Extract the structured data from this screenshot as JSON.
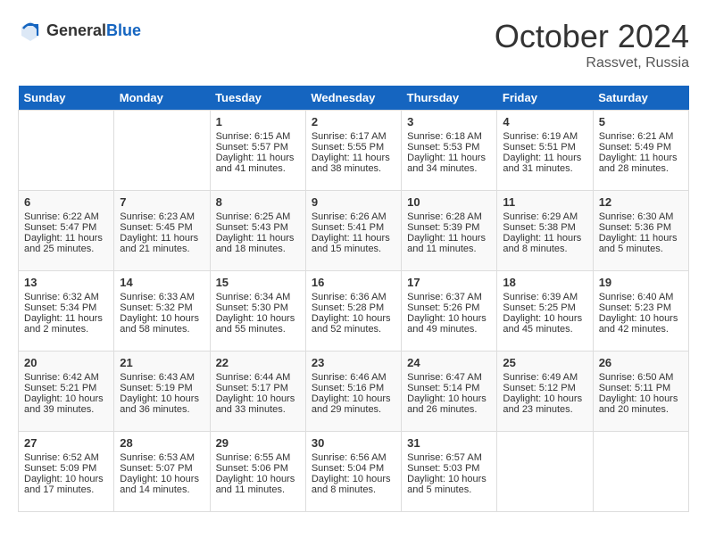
{
  "header": {
    "logo_general": "General",
    "logo_blue": "Blue",
    "month_title": "October 2024",
    "location": "Rassvet, Russia"
  },
  "days_of_week": [
    "Sunday",
    "Monday",
    "Tuesday",
    "Wednesday",
    "Thursday",
    "Friday",
    "Saturday"
  ],
  "weeks": [
    [
      {
        "day": "",
        "sunrise": "",
        "sunset": "",
        "daylight": ""
      },
      {
        "day": "",
        "sunrise": "",
        "sunset": "",
        "daylight": ""
      },
      {
        "day": "1",
        "sunrise": "Sunrise: 6:15 AM",
        "sunset": "Sunset: 5:57 PM",
        "daylight": "Daylight: 11 hours and 41 minutes."
      },
      {
        "day": "2",
        "sunrise": "Sunrise: 6:17 AM",
        "sunset": "Sunset: 5:55 PM",
        "daylight": "Daylight: 11 hours and 38 minutes."
      },
      {
        "day": "3",
        "sunrise": "Sunrise: 6:18 AM",
        "sunset": "Sunset: 5:53 PM",
        "daylight": "Daylight: 11 hours and 34 minutes."
      },
      {
        "day": "4",
        "sunrise": "Sunrise: 6:19 AM",
        "sunset": "Sunset: 5:51 PM",
        "daylight": "Daylight: 11 hours and 31 minutes."
      },
      {
        "day": "5",
        "sunrise": "Sunrise: 6:21 AM",
        "sunset": "Sunset: 5:49 PM",
        "daylight": "Daylight: 11 hours and 28 minutes."
      }
    ],
    [
      {
        "day": "6",
        "sunrise": "Sunrise: 6:22 AM",
        "sunset": "Sunset: 5:47 PM",
        "daylight": "Daylight: 11 hours and 25 minutes."
      },
      {
        "day": "7",
        "sunrise": "Sunrise: 6:23 AM",
        "sunset": "Sunset: 5:45 PM",
        "daylight": "Daylight: 11 hours and 21 minutes."
      },
      {
        "day": "8",
        "sunrise": "Sunrise: 6:25 AM",
        "sunset": "Sunset: 5:43 PM",
        "daylight": "Daylight: 11 hours and 18 minutes."
      },
      {
        "day": "9",
        "sunrise": "Sunrise: 6:26 AM",
        "sunset": "Sunset: 5:41 PM",
        "daylight": "Daylight: 11 hours and 15 minutes."
      },
      {
        "day": "10",
        "sunrise": "Sunrise: 6:28 AM",
        "sunset": "Sunset: 5:39 PM",
        "daylight": "Daylight: 11 hours and 11 minutes."
      },
      {
        "day": "11",
        "sunrise": "Sunrise: 6:29 AM",
        "sunset": "Sunset: 5:38 PM",
        "daylight": "Daylight: 11 hours and 8 minutes."
      },
      {
        "day": "12",
        "sunrise": "Sunrise: 6:30 AM",
        "sunset": "Sunset: 5:36 PM",
        "daylight": "Daylight: 11 hours and 5 minutes."
      }
    ],
    [
      {
        "day": "13",
        "sunrise": "Sunrise: 6:32 AM",
        "sunset": "Sunset: 5:34 PM",
        "daylight": "Daylight: 11 hours and 2 minutes."
      },
      {
        "day": "14",
        "sunrise": "Sunrise: 6:33 AM",
        "sunset": "Sunset: 5:32 PM",
        "daylight": "Daylight: 10 hours and 58 minutes."
      },
      {
        "day": "15",
        "sunrise": "Sunrise: 6:34 AM",
        "sunset": "Sunset: 5:30 PM",
        "daylight": "Daylight: 10 hours and 55 minutes."
      },
      {
        "day": "16",
        "sunrise": "Sunrise: 6:36 AM",
        "sunset": "Sunset: 5:28 PM",
        "daylight": "Daylight: 10 hours and 52 minutes."
      },
      {
        "day": "17",
        "sunrise": "Sunrise: 6:37 AM",
        "sunset": "Sunset: 5:26 PM",
        "daylight": "Daylight: 10 hours and 49 minutes."
      },
      {
        "day": "18",
        "sunrise": "Sunrise: 6:39 AM",
        "sunset": "Sunset: 5:25 PM",
        "daylight": "Daylight: 10 hours and 45 minutes."
      },
      {
        "day": "19",
        "sunrise": "Sunrise: 6:40 AM",
        "sunset": "Sunset: 5:23 PM",
        "daylight": "Daylight: 10 hours and 42 minutes."
      }
    ],
    [
      {
        "day": "20",
        "sunrise": "Sunrise: 6:42 AM",
        "sunset": "Sunset: 5:21 PM",
        "daylight": "Daylight: 10 hours and 39 minutes."
      },
      {
        "day": "21",
        "sunrise": "Sunrise: 6:43 AM",
        "sunset": "Sunset: 5:19 PM",
        "daylight": "Daylight: 10 hours and 36 minutes."
      },
      {
        "day": "22",
        "sunrise": "Sunrise: 6:44 AM",
        "sunset": "Sunset: 5:17 PM",
        "daylight": "Daylight: 10 hours and 33 minutes."
      },
      {
        "day": "23",
        "sunrise": "Sunrise: 6:46 AM",
        "sunset": "Sunset: 5:16 PM",
        "daylight": "Daylight: 10 hours and 29 minutes."
      },
      {
        "day": "24",
        "sunrise": "Sunrise: 6:47 AM",
        "sunset": "Sunset: 5:14 PM",
        "daylight": "Daylight: 10 hours and 26 minutes."
      },
      {
        "day": "25",
        "sunrise": "Sunrise: 6:49 AM",
        "sunset": "Sunset: 5:12 PM",
        "daylight": "Daylight: 10 hours and 23 minutes."
      },
      {
        "day": "26",
        "sunrise": "Sunrise: 6:50 AM",
        "sunset": "Sunset: 5:11 PM",
        "daylight": "Daylight: 10 hours and 20 minutes."
      }
    ],
    [
      {
        "day": "27",
        "sunrise": "Sunrise: 6:52 AM",
        "sunset": "Sunset: 5:09 PM",
        "daylight": "Daylight: 10 hours and 17 minutes."
      },
      {
        "day": "28",
        "sunrise": "Sunrise: 6:53 AM",
        "sunset": "Sunset: 5:07 PM",
        "daylight": "Daylight: 10 hours and 14 minutes."
      },
      {
        "day": "29",
        "sunrise": "Sunrise: 6:55 AM",
        "sunset": "Sunset: 5:06 PM",
        "daylight": "Daylight: 10 hours and 11 minutes."
      },
      {
        "day": "30",
        "sunrise": "Sunrise: 6:56 AM",
        "sunset": "Sunset: 5:04 PM",
        "daylight": "Daylight: 10 hours and 8 minutes."
      },
      {
        "day": "31",
        "sunrise": "Sunrise: 6:57 AM",
        "sunset": "Sunset: 5:03 PM",
        "daylight": "Daylight: 10 hours and 5 minutes."
      },
      {
        "day": "",
        "sunrise": "",
        "sunset": "",
        "daylight": ""
      },
      {
        "day": "",
        "sunrise": "",
        "sunset": "",
        "daylight": ""
      }
    ]
  ]
}
